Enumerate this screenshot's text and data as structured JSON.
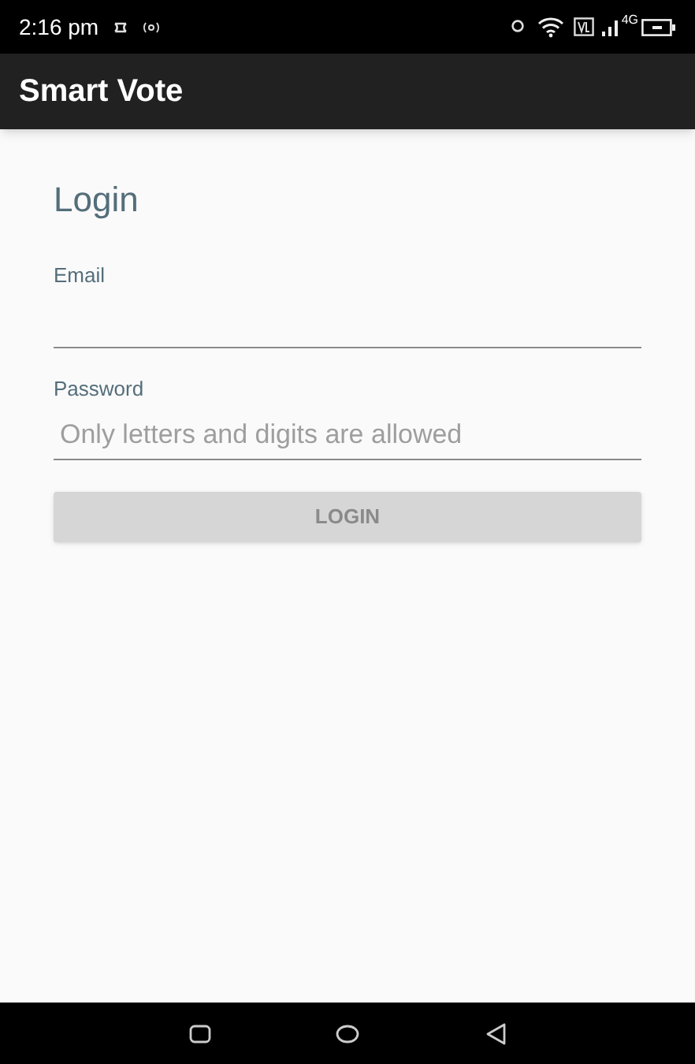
{
  "status_bar": {
    "time": "2:16 pm",
    "network": "4G"
  },
  "app_bar": {
    "title": "Smart Vote"
  },
  "form": {
    "title": "Login",
    "fields": [
      {
        "label": "Email"
      },
      {
        "label": "Password",
        "placeholder": "Only letters and digits are allowed"
      }
    ],
    "button": {
      "label": "LOGIN",
      "disabled": true
    }
  }
}
